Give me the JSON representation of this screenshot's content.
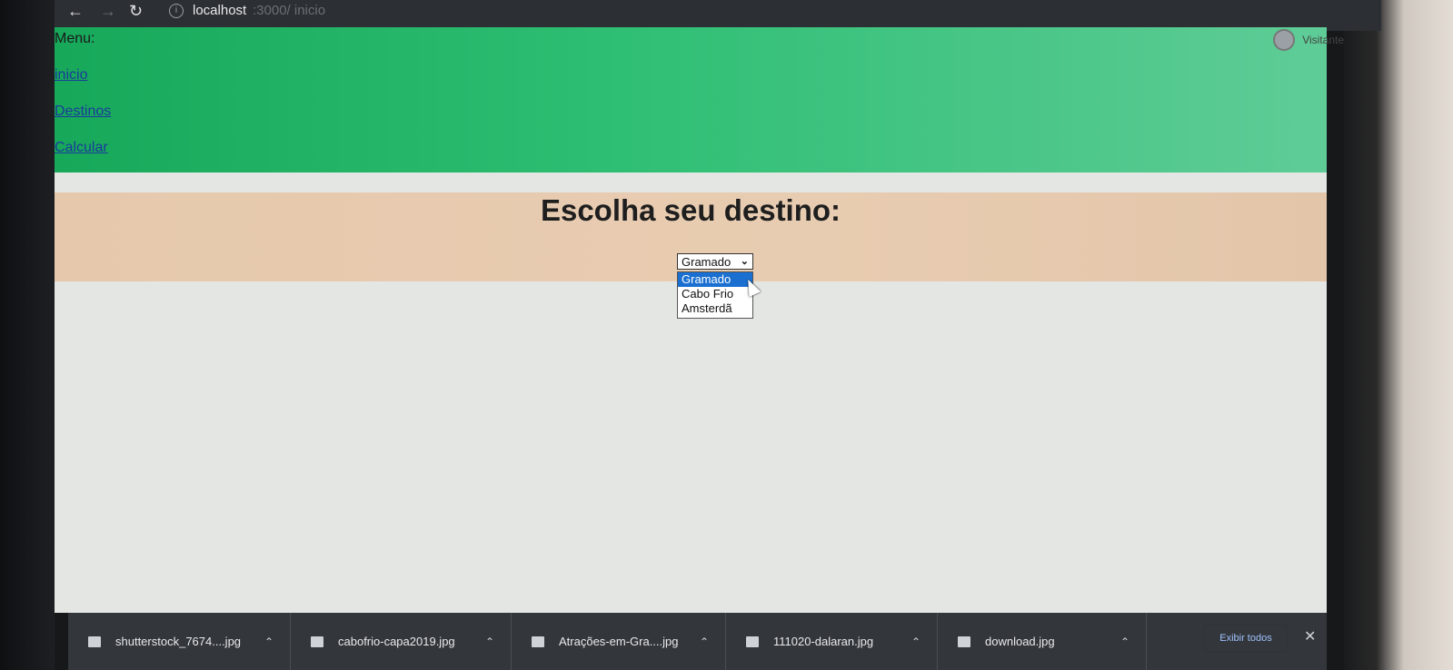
{
  "browser": {
    "url_host": "localhost",
    "url_path": ":3000/ inicio",
    "profile_label": "Visitante"
  },
  "page": {
    "menu_label": "Menu:",
    "links": [
      "inicio",
      "Destinos",
      "Calcular"
    ],
    "heading": "Escolha seu destino:",
    "select": {
      "selected": "Gramado",
      "options": [
        "Gramado",
        "Cabo Frio",
        "Amsterdã"
      ]
    }
  },
  "downloads": {
    "items": [
      "shutterstock_7674....jpg",
      "cabofrio-capa2019.jpg",
      "Atrações-em-Gra....jpg",
      "111020-dalaran.jpg",
      "download.jpg"
    ],
    "show_all_label": "Exibir todos"
  },
  "colors": {
    "menu_band": "#2fbf74",
    "title_band": "#e8ccb1",
    "selected_option": "#1a6fd0"
  }
}
